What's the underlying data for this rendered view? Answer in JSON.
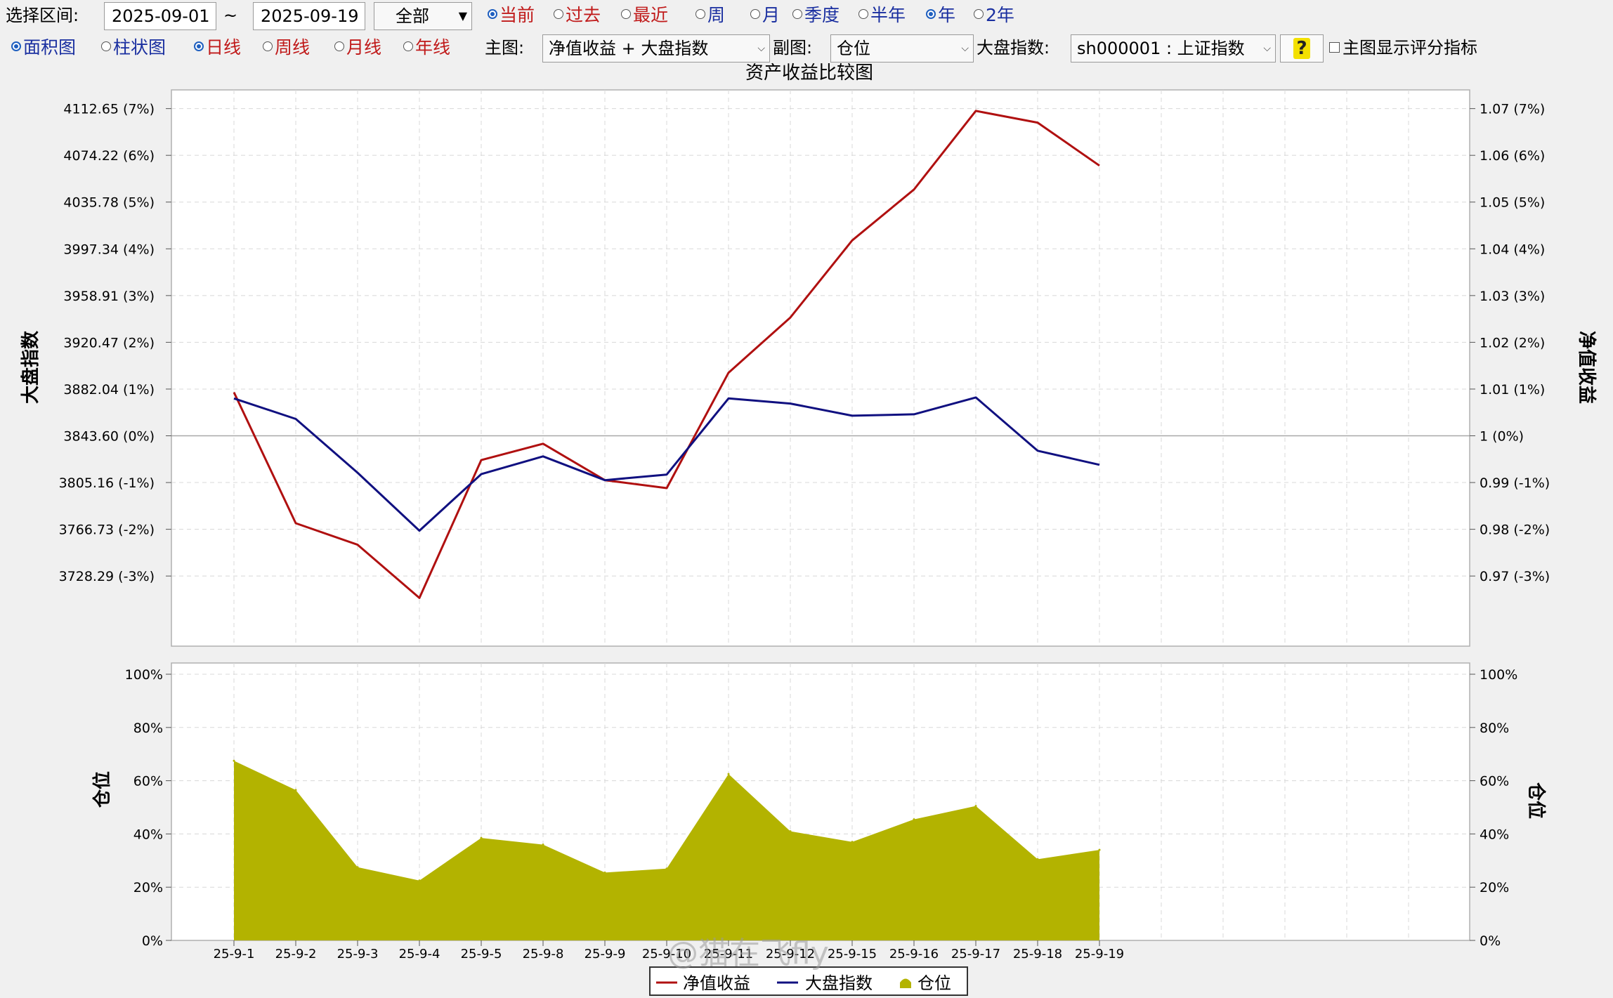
{
  "toolbar": {
    "range_label": "选择区间:",
    "date_start": "2025-09-01",
    "date_sep": "~",
    "date_end": "2025-09-19",
    "scope_select": "全部",
    "period_radios": [
      {
        "label": "当前",
        "checked": true,
        "color": "#c01a1a"
      },
      {
        "label": "过去",
        "checked": false,
        "color": "#c01a1a"
      },
      {
        "label": "最近",
        "checked": false,
        "color": "#c01a1a"
      },
      {
        "label": "周",
        "checked": false,
        "color": "#1a2fa0"
      },
      {
        "label": "月",
        "checked": false,
        "color": "#1a2fa0"
      },
      {
        "label": "季度",
        "checked": false,
        "color": "#1a2fa0"
      },
      {
        "label": "半年",
        "checked": false,
        "color": "#1a2fa0"
      },
      {
        "label": "年",
        "checked": true,
        "color": "#1a2fa0"
      },
      {
        "label": "2年",
        "checked": false,
        "color": "#1a2fa0"
      }
    ],
    "chart_type_radios": [
      {
        "label": "面积图",
        "checked": true
      },
      {
        "label": "柱状图",
        "checked": false
      }
    ],
    "freq_radios": [
      {
        "label": "日线",
        "checked": true
      },
      {
        "label": "周线",
        "checked": false
      },
      {
        "label": "月线",
        "checked": false
      },
      {
        "label": "年线",
        "checked": false
      }
    ],
    "main_label": "主图:",
    "main_select": "净值收益 + 大盘指数",
    "sub_label": "副图:",
    "sub_select": "仓位",
    "index_label": "大盘指数:",
    "index_select": "sh000001 : 上证指数",
    "help_glyph": "?",
    "score_checkbox_label": "主图显示评分指标"
  },
  "chart_data": {
    "type": "line",
    "title": "资产收益比较图",
    "categories": [
      "25-9-1",
      "25-9-2",
      "25-9-3",
      "25-9-4",
      "25-9-5",
      "25-9-8",
      "25-9-9",
      "25-9-10",
      "25-9-11",
      "25-9-12",
      "25-9-15",
      "25-9-16",
      "25-9-17",
      "25-9-18",
      "25-9-19"
    ],
    "x_tick_labels": [
      "25-9-1",
      "25-9-2",
      "25-9-3",
      "25-9-4",
      "25-9-5",
      "25-9-8",
      "25-9-9",
      "25-9-10",
      "25-9-11",
      "25-9-12",
      "25-9-15",
      "25-9-16",
      "25-9-17",
      "25-9-18",
      "25-9-19"
    ],
    "main_panel": {
      "ylabel_left": "大盘指数",
      "ylabel_right": "净值收益",
      "ylim_pct": [
        -4.5,
        7.4
      ],
      "left_ticks": [
        {
          "pct": 7,
          "label": "4112.65 (7%)"
        },
        {
          "pct": 6,
          "label": "4074.22 (6%)"
        },
        {
          "pct": 5,
          "label": "4035.78 (5%)"
        },
        {
          "pct": 4,
          "label": "3997.34 (4%)"
        },
        {
          "pct": 3,
          "label": "3958.91 (3%)"
        },
        {
          "pct": 2,
          "label": "3920.47 (2%)"
        },
        {
          "pct": 1,
          "label": "3882.04 (1%)"
        },
        {
          "pct": 0,
          "label": "3843.60 (0%)"
        },
        {
          "pct": -1,
          "label": "3805.16 (-1%)"
        },
        {
          "pct": -2,
          "label": "3766.73 (-2%)"
        },
        {
          "pct": -3,
          "label": "3728.29 (-3%)"
        }
      ],
      "right_ticks": [
        {
          "pct": 7,
          "label": "1.07 (7%)"
        },
        {
          "pct": 6,
          "label": "1.06 (6%)"
        },
        {
          "pct": 5,
          "label": "1.05 (5%)"
        },
        {
          "pct": 4,
          "label": "1.04 (4%)"
        },
        {
          "pct": 3,
          "label": "1.03 (3%)"
        },
        {
          "pct": 2,
          "label": "1.02 (2%)"
        },
        {
          "pct": 1,
          "label": "1.01 (1%)"
        },
        {
          "pct": 0,
          "label": "1 (0%)"
        },
        {
          "pct": -1,
          "label": "0.99 (-1%)"
        },
        {
          "pct": -2,
          "label": "0.98 (-2%)"
        },
        {
          "pct": -3,
          "label": "0.97 (-3%)"
        }
      ],
      "series": [
        {
          "name": "净值收益",
          "color": "#b01010",
          "values": [
            0.93,
            -1.87,
            -2.33,
            -3.47,
            -0.52,
            -0.17,
            -0.95,
            -1.12,
            1.35,
            2.53,
            4.18,
            5.27,
            6.95,
            6.7,
            5.78
          ]
        },
        {
          "name": "大盘指数",
          "color": "#101080",
          "values": [
            0.8,
            0.36,
            -0.79,
            -2.03,
            -0.82,
            -0.44,
            -0.95,
            -0.83,
            0.8,
            0.69,
            0.43,
            0.46,
            0.82,
            -0.32,
            -0.62
          ]
        }
      ]
    },
    "sub_panel": {
      "ylabel_left": "仓位",
      "ylabel_right": "仓位",
      "ylim": [
        0,
        100
      ],
      "ticks": [
        "0%",
        "20%",
        "40%",
        "60%",
        "80%",
        "100%"
      ],
      "series": [
        {
          "name": "仓位",
          "color": "#b3b300",
          "values": [
            67.5,
            56.5,
            27.5,
            22.5,
            38.5,
            36,
            25.5,
            27,
            62.5,
            41,
            37,
            45.5,
            50.5,
            30.5,
            34
          ]
        }
      ]
    },
    "legend": {
      "position": "bottom-center",
      "items": [
        "净值收益",
        "大盘指数",
        "仓位"
      ]
    },
    "grid": true
  },
  "watermark": "@猫在飞fly"
}
